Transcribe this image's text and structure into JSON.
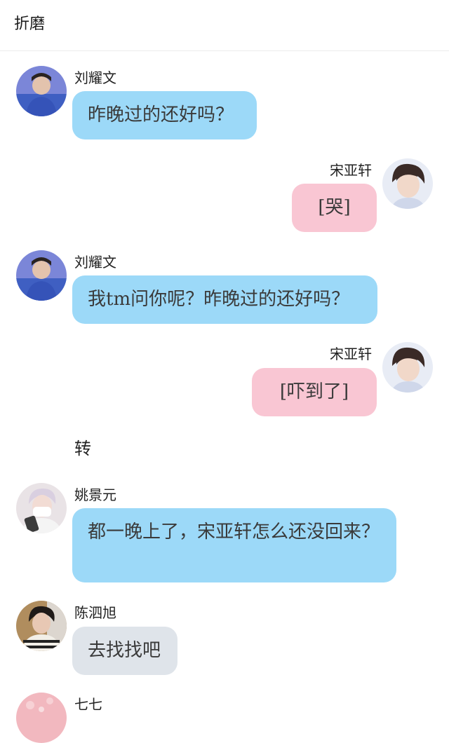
{
  "header": {
    "title": "折磨"
  },
  "messages": [
    {
      "sender": "刘耀文",
      "text": "昨晚过的还好吗？",
      "color": "#9cd9f8"
    },
    {
      "sender": "宋亚轩",
      "text": "[哭]",
      "color": "#f9c6d3"
    },
    {
      "sender": "刘耀文",
      "text": "我tm问你呢？昨晚过的还好吗？",
      "color": "#9cd9f8"
    },
    {
      "sender": "宋亚轩",
      "text": "[吓到了]",
      "color": "#f9c6d3"
    },
    {
      "sender": "姚景元",
      "text": "都一晚上了，宋亚轩怎么还没回来？",
      "color": "#9cd9f8"
    },
    {
      "sender": "陈泗旭",
      "text": "去找找吧",
      "color": "#dfe4ea"
    },
    {
      "sender": "七七"
    }
  ],
  "divider": {
    "text": "转"
  }
}
